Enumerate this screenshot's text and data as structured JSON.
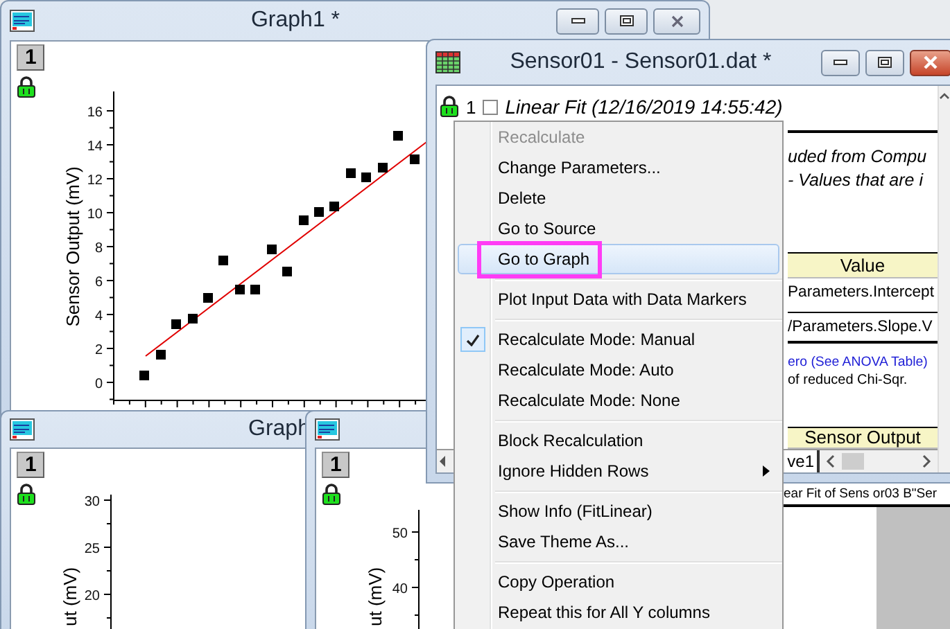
{
  "graph_windows": [
    {
      "title": "Graph1 *",
      "layer": "1",
      "y_axis_title": "Sensor Output (mV)",
      "y_tick_labels": [
        "16",
        "14",
        "12",
        "10",
        "8",
        "6",
        "4",
        "2",
        "0"
      ]
    },
    {
      "title": "Graph",
      "layer": "1",
      "y_axis_title": "ut (mV)",
      "y_tick_labels": [
        "30",
        "25",
        "20"
      ]
    },
    {
      "layer": "1",
      "y_axis_title": "ut (mV)",
      "y_tick_labels": [
        "50",
        "40"
      ]
    }
  ],
  "worksheet": {
    "title": "Sensor01 - Sensor01.dat *",
    "fit_row": {
      "number": "1",
      "checked": false,
      "label": "Linear Fit (12/16/2019 14:55:42)"
    },
    "notes": [
      "uded from Compu",
      "- Values that are i"
    ],
    "header": "Value",
    "cells": [
      "Parameters.Intercept",
      "/Parameters.Slope.V"
    ],
    "link_text": "ero (See ANOVA Table)",
    "small_note": "of reduced Chi-Sqr.",
    "column_header": "Sensor Output",
    "sheet_tab": "ve1"
  },
  "report_window": {
    "caption": "ear Fit of Sens or03 B\"Ser"
  },
  "context_menu": {
    "items": [
      {
        "kind": "item",
        "label": "Recalculate",
        "disabled": true,
        "checked": false,
        "selected": false,
        "submenu": false
      },
      {
        "kind": "item",
        "label": "Change Parameters...",
        "disabled": false,
        "checked": false,
        "selected": false,
        "submenu": false
      },
      {
        "kind": "item",
        "label": "Delete",
        "disabled": false,
        "checked": false,
        "selected": false,
        "submenu": false
      },
      {
        "kind": "item",
        "label": "Go to Source",
        "disabled": false,
        "checked": false,
        "selected": false,
        "submenu": false
      },
      {
        "kind": "item",
        "label": "Go to Graph",
        "disabled": false,
        "checked": false,
        "selected": true,
        "submenu": false
      },
      {
        "kind": "separator"
      },
      {
        "kind": "item",
        "label": "Plot Input Data with Data Markers",
        "disabled": false,
        "checked": false,
        "selected": false,
        "submenu": false
      },
      {
        "kind": "separator"
      },
      {
        "kind": "item",
        "label": "Recalculate Mode: Manual",
        "disabled": false,
        "checked": true,
        "selected": false,
        "submenu": false
      },
      {
        "kind": "item",
        "label": "Recalculate Mode: Auto",
        "disabled": false,
        "checked": false,
        "selected": false,
        "submenu": false
      },
      {
        "kind": "item",
        "label": "Recalculate Mode: None",
        "disabled": false,
        "checked": false,
        "selected": false,
        "submenu": false
      },
      {
        "kind": "separator"
      },
      {
        "kind": "item",
        "label": "Block Recalculation",
        "disabled": false,
        "checked": false,
        "selected": false,
        "submenu": false
      },
      {
        "kind": "item",
        "label": "Ignore Hidden Rows",
        "disabled": false,
        "checked": false,
        "selected": false,
        "submenu": true
      },
      {
        "kind": "separator"
      },
      {
        "kind": "item",
        "label": "Show Info (FitLinear)",
        "disabled": false,
        "checked": false,
        "selected": false,
        "submenu": false
      },
      {
        "kind": "item",
        "label": "Save Theme As...",
        "disabled": false,
        "checked": false,
        "selected": false,
        "submenu": false
      },
      {
        "kind": "separator"
      },
      {
        "kind": "item",
        "label": "Copy Operation",
        "disabled": false,
        "checked": false,
        "selected": false,
        "submenu": false
      },
      {
        "kind": "item",
        "label": "Repeat this for All Y columns",
        "disabled": false,
        "checked": false,
        "selected": false,
        "submenu": false
      }
    ]
  }
}
